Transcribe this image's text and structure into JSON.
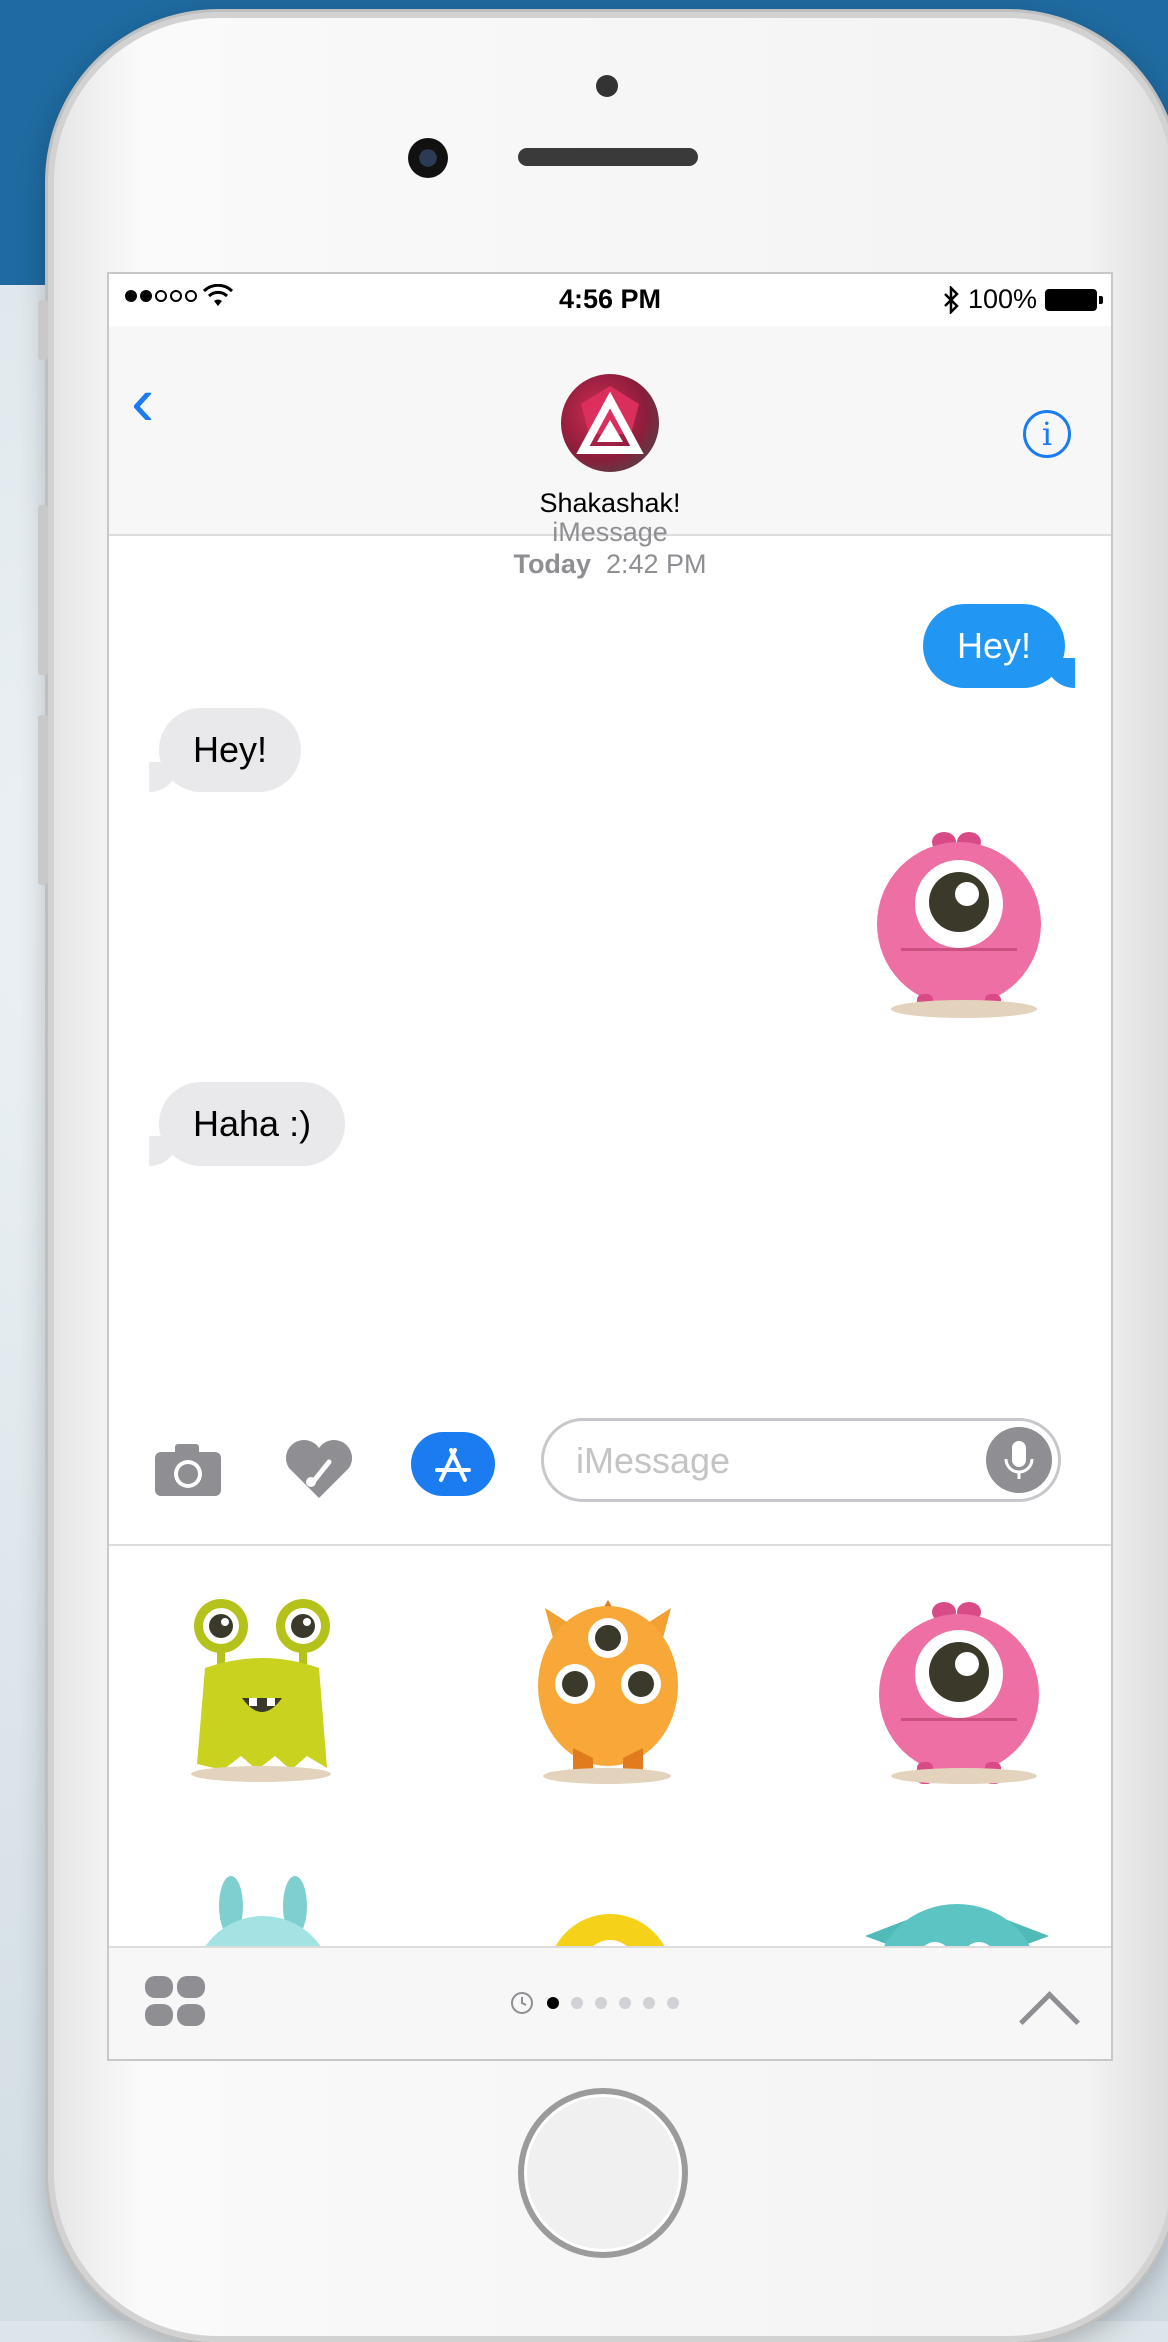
{
  "status_bar": {
    "time": "4:56 PM",
    "battery": "100%",
    "signal_bars_filled": 2,
    "signal_bars_total": 5
  },
  "nav": {
    "contact_name": "Shakashak!",
    "info_glyph": "i"
  },
  "conversation": {
    "service": "iMessage",
    "day": "Today",
    "time": "2:42 PM",
    "messages": [
      {
        "direction": "out",
        "text": "Hey!"
      },
      {
        "direction": "in",
        "text": "Hey!"
      },
      {
        "direction": "out",
        "sticker": "pink-one-eyed-monster"
      },
      {
        "direction": "in",
        "text": "Haha :)"
      }
    ]
  },
  "input_bar": {
    "placeholder": "iMessage",
    "icons": [
      "camera-icon",
      "digital-touch-icon",
      "app-store-icon",
      "microphone-icon"
    ]
  },
  "sticker_drawer": {
    "stickers": [
      "green-monster",
      "orange-three-eyed-monster",
      "pink-one-eyed-monster",
      "teal-bunny-monster",
      "yellow-one-eyed-monster",
      "teal-fuzzy-monster"
    ],
    "page_count": 6,
    "active_page": 0
  },
  "colors": {
    "accent_blue": "#1a7cf0",
    "outgoing_bubble": "#2196f3",
    "incoming_bubble": "#e9e9eb"
  }
}
